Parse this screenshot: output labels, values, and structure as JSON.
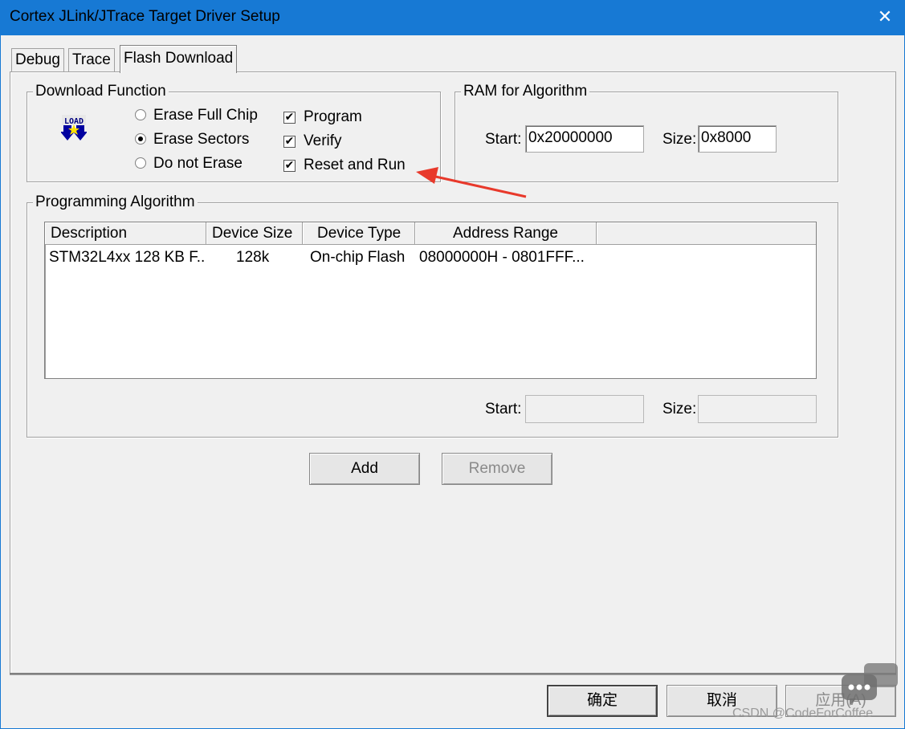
{
  "window": {
    "title": "Cortex JLink/JTrace Target Driver Setup",
    "close_glyph": "✕"
  },
  "tabs": [
    {
      "label": "Debug"
    },
    {
      "label": "Trace"
    },
    {
      "label": "Flash Download"
    }
  ],
  "download_function": {
    "legend": "Download Function",
    "icon_text": "LOAD",
    "erase_options": [
      {
        "label": "Erase Full Chip",
        "selected": false
      },
      {
        "label": "Erase Sectors",
        "selected": true
      },
      {
        "label": "Do not Erase",
        "selected": false
      }
    ],
    "actions": [
      {
        "label": "Program",
        "checked": true
      },
      {
        "label": "Verify",
        "checked": true
      },
      {
        "label": "Reset and Run",
        "checked": true
      }
    ],
    "check_glyph": "✔"
  },
  "ram_for_algorithm": {
    "legend": "RAM for Algorithm",
    "start_label": "Start:",
    "start_value": "0x20000000",
    "size_label": "Size:",
    "size_value": "0x8000"
  },
  "programming_algorithm": {
    "legend": "Programming Algorithm",
    "columns": [
      "Description",
      "Device Size",
      "Device Type",
      "Address Range"
    ],
    "rows": [
      [
        "STM32L4xx 128 KB F...",
        "128k",
        "On-chip Flash",
        "08000000H - 0801FFF..."
      ]
    ],
    "start_label": "Start:",
    "start_value": "",
    "size_label": "Size:",
    "size_value": ""
  },
  "buttons": {
    "add": "Add",
    "remove": "Remove"
  },
  "footer": {
    "ok": "确定",
    "cancel": "取消",
    "apply": "应用(A)"
  },
  "watermark": "CSDN @CodeForCoffee",
  "colors": {
    "titlebar": "#1779d4",
    "annotation_arrow": "#e8392b"
  }
}
